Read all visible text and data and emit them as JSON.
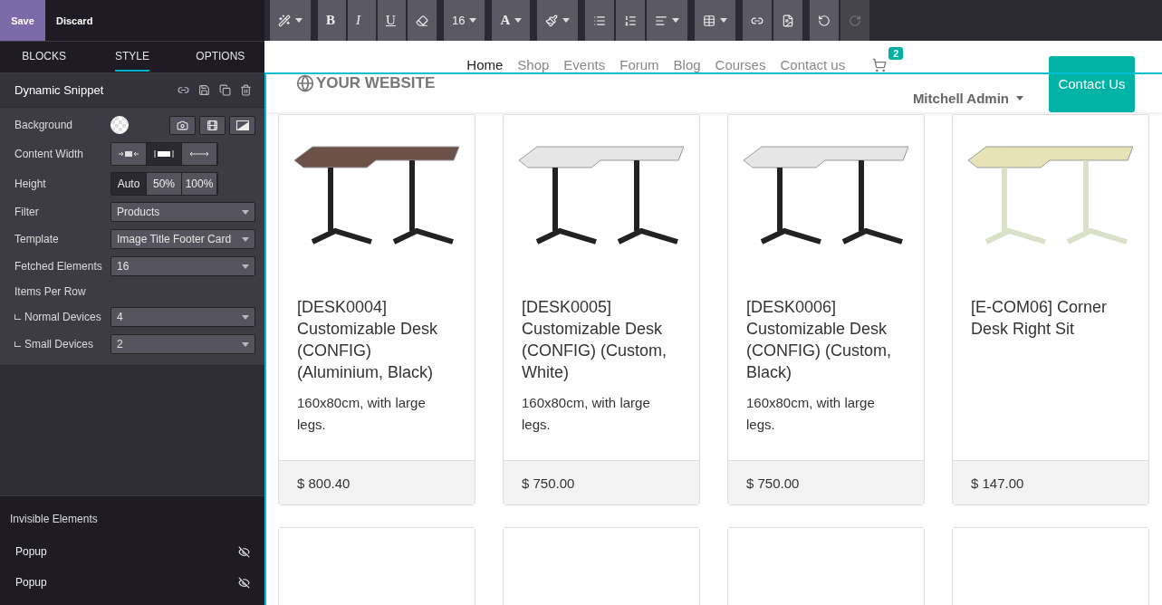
{
  "editor_bar": {
    "save": "Save",
    "discard": "Discard"
  },
  "panel_tabs": [
    {
      "label": "BLOCKS",
      "selected": false
    },
    {
      "label": "STYLE",
      "selected": true
    },
    {
      "label": "OPTIONS",
      "selected": false
    }
  ],
  "snippet": {
    "title": "Dynamic Snippet"
  },
  "options": [
    {
      "kind": "background",
      "label": "Background"
    },
    {
      "kind": "segmented",
      "label": "Content Width",
      "choices": [
        {
          "kind": "narrow",
          "selected": false
        },
        {
          "kind": "medium",
          "selected": true
        },
        {
          "kind": "full",
          "selected": false
        }
      ]
    },
    {
      "kind": "segmented",
      "label": "Height",
      "choices": [
        {
          "text": "Auto",
          "selected": true
        },
        {
          "text": "50%",
          "selected": false
        },
        {
          "text": "100%",
          "selected": false
        }
      ]
    },
    {
      "kind": "select",
      "label": "Filter",
      "value": "Products"
    },
    {
      "kind": "select",
      "label": "Template",
      "value": "Image Title Footer Card"
    },
    {
      "kind": "select",
      "label": "Fetched Elements",
      "value": "16"
    },
    {
      "kind": "heading",
      "label": "Items Per Row"
    },
    {
      "kind": "select",
      "label": "Normal Devices",
      "value": "4",
      "nested": true
    },
    {
      "kind": "select",
      "label": "Small Devices",
      "value": "2",
      "nested": true
    }
  ],
  "invisible": {
    "title": "Invisible Elements",
    "items": [
      {
        "label": "Popup"
      },
      {
        "label": "Popup"
      }
    ]
  },
  "toolbar": [
    [
      {
        "kind": "wand",
        "dropdown": true,
        "disabled": false
      }
    ],
    [
      {
        "kind": "bold",
        "text": "B",
        "dropdown": false,
        "disabled": false
      },
      {
        "kind": "italic",
        "text": "I",
        "dropdown": false,
        "disabled": false
      },
      {
        "kind": "underline",
        "text": "U",
        "dropdown": false,
        "disabled": false
      },
      {
        "kind": "eraser",
        "dropdown": false,
        "disabled": false
      }
    ],
    [
      {
        "kind": "size",
        "text": "16",
        "dropdown": true,
        "disabled": false
      }
    ],
    [
      {
        "kind": "fontcolor",
        "text": "A",
        "dropdown": true,
        "disabled": false
      }
    ],
    [
      {
        "kind": "brush",
        "dropdown": true,
        "disabled": false
      }
    ],
    [
      {
        "kind": "bullets",
        "dropdown": false,
        "disabled": false
      },
      {
        "kind": "numbers",
        "dropdown": false,
        "disabled": false
      },
      {
        "kind": "align",
        "dropdown": true,
        "disabled": false
      }
    ],
    [
      {
        "kind": "table",
        "dropdown": true,
        "disabled": false
      }
    ],
    [
      {
        "kind": "link",
        "dropdown": false,
        "disabled": false
      },
      {
        "kind": "image",
        "dropdown": false,
        "disabled": false
      }
    ],
    [
      {
        "kind": "undo",
        "dropdown": false,
        "disabled": false
      },
      {
        "kind": "redo",
        "dropdown": false,
        "disabled": true
      }
    ]
  ],
  "site": {
    "logo": "YOUR WEBSITE",
    "nav": [
      {
        "label": "Home",
        "selected": true
      },
      {
        "label": "Shop",
        "selected": false
      },
      {
        "label": "Events",
        "selected": false
      },
      {
        "label": "Forum",
        "selected": false
      },
      {
        "label": "Blog",
        "selected": false
      },
      {
        "label": "Courses",
        "selected": false
      },
      {
        "label": "Contact us",
        "selected": false
      }
    ],
    "cart_count": "2",
    "user": "Mitchell Admin",
    "cta": "Contact Us"
  },
  "products": [
    {
      "kind": "full",
      "title": "[DESK0004] Customizable Desk (CONFIG) (Aluminium, Black)",
      "description": "160x80cm, with large legs.",
      "price": "$ 800.40"
    },
    {
      "kind": "full",
      "title": "[DESK0005] Customizable Desk (CONFIG) (Custom, White)",
      "description": "160x80cm, with large legs.",
      "price": "$ 750.00"
    },
    {
      "kind": "full",
      "title": "[DESK0006] Customizable Desk (CONFIG) (Custom, Black)",
      "description": "160x80cm, with large legs.",
      "price": "$ 750.00"
    },
    {
      "kind": "full",
      "title": "[E-COM06] Corner Desk Right Sit",
      "price": "$ 147.00"
    },
    {
      "kind": "image-only"
    },
    {
      "kind": "image-only"
    },
    {
      "kind": "image-only"
    },
    {
      "kind": "image-only"
    }
  ]
}
